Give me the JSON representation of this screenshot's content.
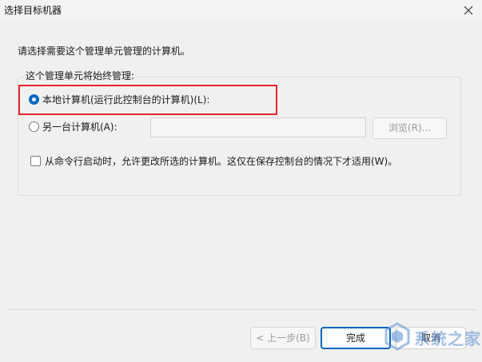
{
  "window": {
    "title": "选择目标机器"
  },
  "instruction": "请选择需要这个管理单元管理的计算机。",
  "group": {
    "label": "这个管理单元将始终管理:",
    "option_local": {
      "label": "本地计算机(运行此控制台的计算机)(L):",
      "selected": true
    },
    "option_other": {
      "label": "另一台计算机(A):",
      "selected": false,
      "input_value": ""
    },
    "browse_label": "浏览(R)..."
  },
  "checkbox": {
    "label": "从命令行启动时，允许更改所选的计算机。这仅在保存控制台的情况下才适用(W)。",
    "checked": false
  },
  "buttons": {
    "back": "< 上一步(B)",
    "finish": "完成",
    "cancel": "取消"
  },
  "watermark": {
    "text": "系统之家"
  },
  "colors": {
    "accent": "#0067c0",
    "highlight": "#e5262a"
  }
}
